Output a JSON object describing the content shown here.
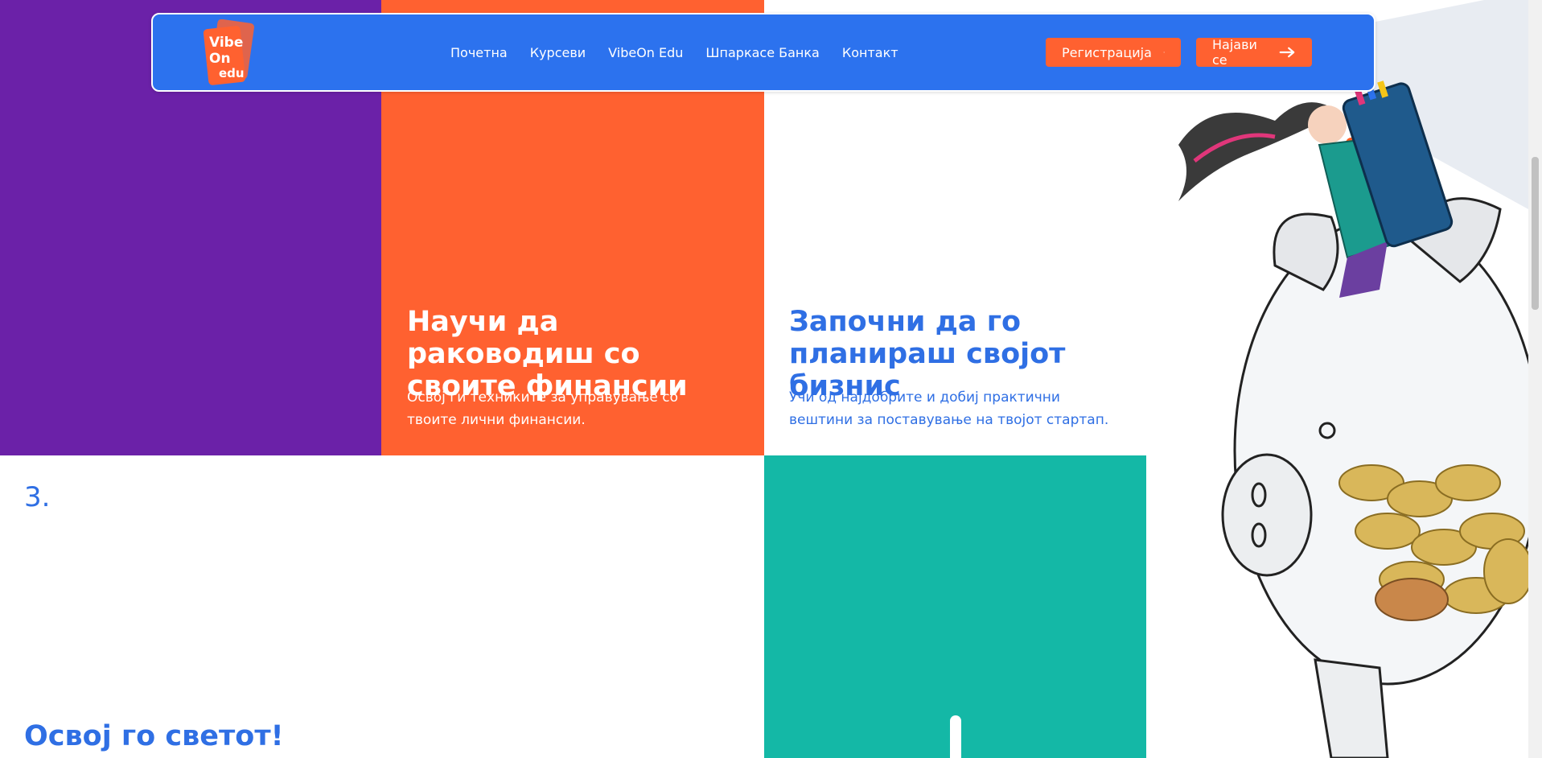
{
  "logo": {
    "text_lines": [
      "Vibe",
      "On",
      "edu"
    ]
  },
  "nav": {
    "links": [
      "Почетна",
      "Курсеви",
      "VibeOn Edu",
      "Шпаркасе Банка",
      "Контакт"
    ],
    "register_label": "Регистрација",
    "login_label": "Најави се"
  },
  "tiles": {
    "finance": {
      "title": "Научи да раководиш со своите финансии",
      "description": "Освој ги техниките за управување со твоите лични финансии."
    },
    "business": {
      "title": "Започни да го планираш својот бизнис",
      "description": "Учи од најдобрите и добиј практични вештини за поставување на твојот стартап."
    },
    "conquer": {
      "number": "3.",
      "title": "Освој го светот!"
    }
  },
  "colors": {
    "primary_blue": "#2c72ee",
    "accent_orange": "#ff6130",
    "purple": "#6b21a8",
    "teal": "#14b8a6"
  },
  "icons": [
    "arrow-right-icon",
    "piggy-bank-illustration"
  ]
}
